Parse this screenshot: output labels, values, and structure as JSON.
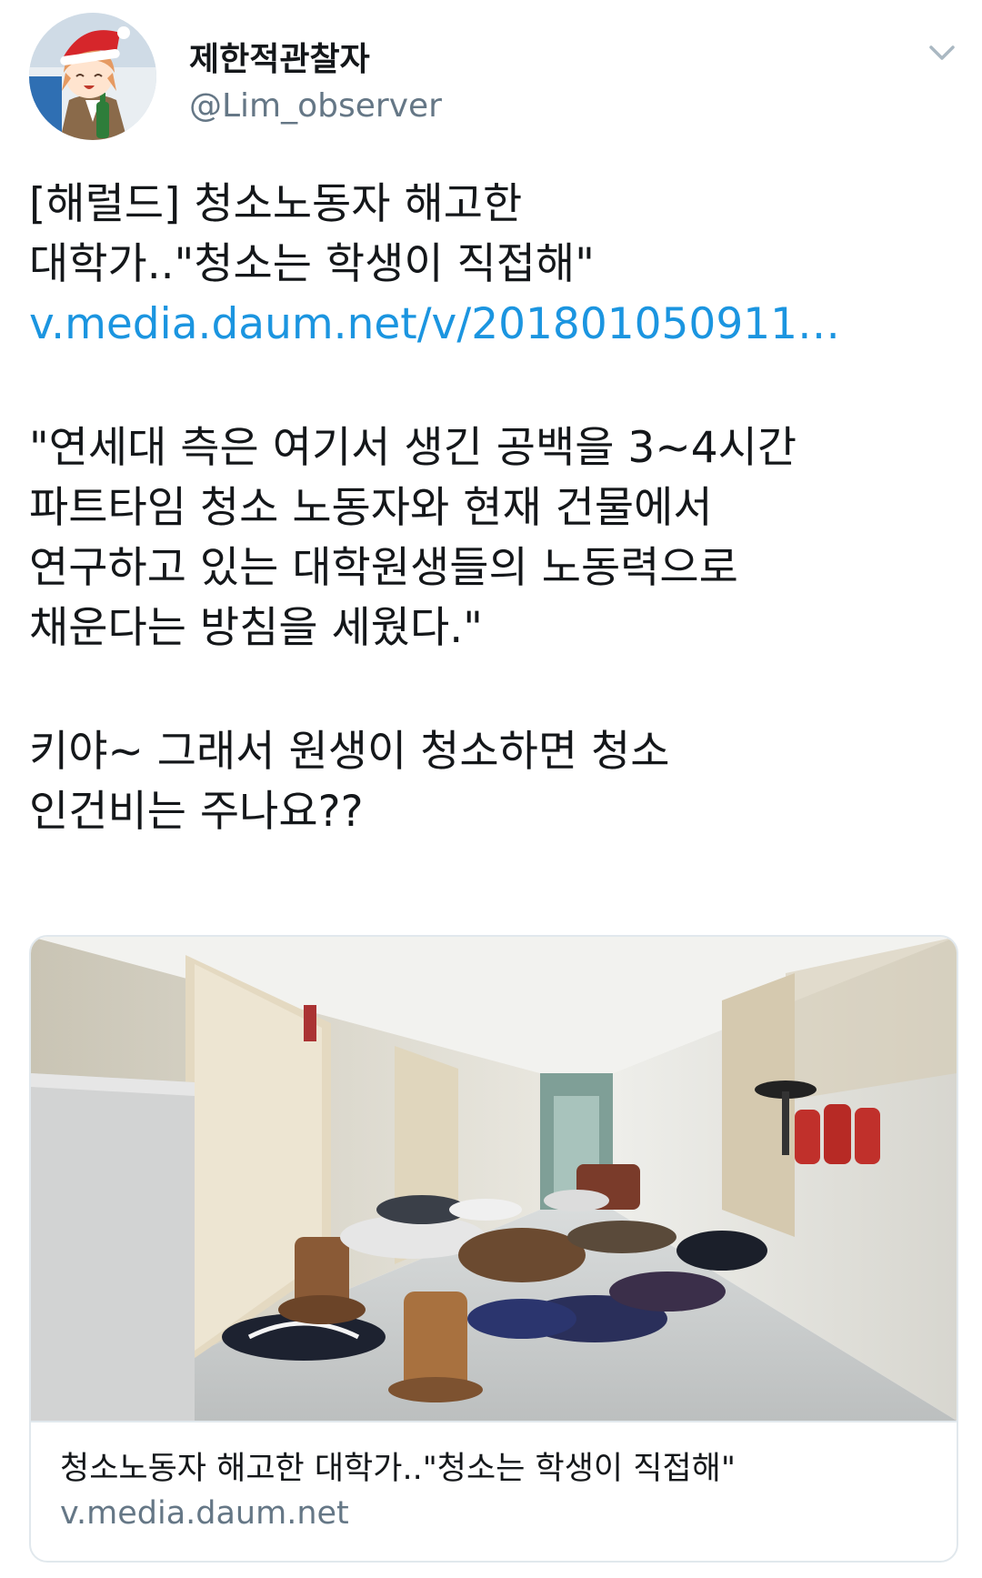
{
  "user": {
    "display_name": "제한적관찰자",
    "handle": "@Lim_observer"
  },
  "icons": {
    "avatar": "anime-santa-avatar",
    "menu": "chevron-down-icon"
  },
  "tweet": {
    "headline_line1": "[해럴드] 청소노동자 해고한",
    "headline_line2": "대학가..\"청소는 학생이 직접해\"",
    "link_text": "v.media.daum.net/v/201801050911…",
    "quote_line1": "\"연세대 측은 여기서 생긴 공백을 3~4시간",
    "quote_line2": "파트타임 청소 노동자와 현재 건물에서",
    "quote_line3": "연구하고 있는 대학원생들의 노동력으로",
    "quote_line4": "채운다는  방침을 세웠다.\"",
    "comment_line1": "키야~ 그래서 원생이 청소하면 청소",
    "comment_line2": "인건비는 주나요??"
  },
  "card": {
    "image_subject": "hallway-shoes-photo",
    "title": "청소노동자 해고한 대학가..\"청소는 학생이 직접해\"",
    "domain": "v.media.daum.net"
  },
  "colors": {
    "link": "#1b95e0",
    "secondary_text": "#657786",
    "border": "#e1e8ed"
  }
}
